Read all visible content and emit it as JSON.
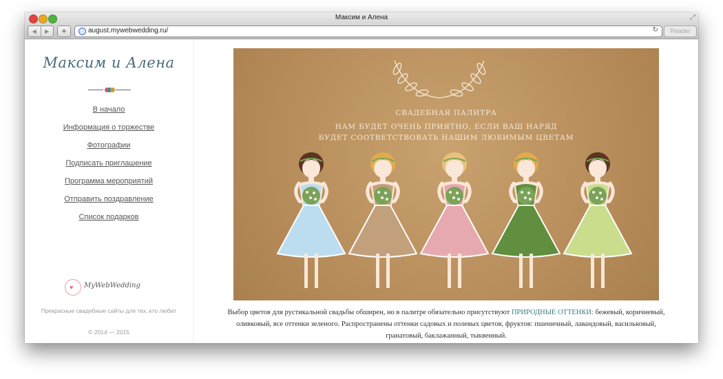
{
  "window": {
    "title": "Максим и Алена"
  },
  "toolbar": {
    "url": "august.mywebwedding.ru/",
    "reader_label": "Reader"
  },
  "icons": {
    "back": "back-arrow-icon",
    "forward": "forward-arrow-icon",
    "add_tab": "plus-icon",
    "site": "globe-icon",
    "reload": "reload-icon",
    "fullscreen": "fullscreen-icon",
    "hearts": "hearts-icon",
    "wreath": "laurel-wreath-icon"
  },
  "sidebar": {
    "logo_text": "Максим и Алена",
    "nav": [
      {
        "label": "В начало"
      },
      {
        "label": "Информация о торжестве"
      },
      {
        "label": "Фотографии"
      },
      {
        "label": "Подписать приглашение"
      },
      {
        "label": "Программа мероприятий"
      },
      {
        "label": "Отправить поздравление"
      },
      {
        "label": "Список подарков"
      }
    ],
    "footer": {
      "brand": "MyWebWedding",
      "tagline": "Прекрасные свадебные сайты для тех, кто любит",
      "copyright": "© 2014 — 2015"
    }
  },
  "hero": {
    "line1": "СВАДЕБНАЯ ПАЛИТРА",
    "line2": "НАМ БУДЕТ ОЧЕНЬ ПРИЯТНО, ЕСЛИ ВАШ НАРЯД",
    "line3": "БУДЕТ СООТВЕТСТВОВАТЬ НАШИМ ЛЮБИМЫМ ЦВЕТАМ",
    "dresses": [
      {
        "dress": "#bcdcef",
        "hair": "#5a3520"
      },
      {
        "dress": "#c1a07b",
        "hair": "#e0ab4b"
      },
      {
        "dress": "#e6a9b0",
        "hair": "#e8c27a"
      },
      {
        "dress": "#5f8f3f",
        "hair": "#e0ab4b"
      },
      {
        "dress": "#c9dd8d",
        "hair": "#5a3520"
      }
    ],
    "skin": "#fbe7d8",
    "bouquet": "#7aa35a"
  },
  "caption": {
    "part1": "Выбор цветов для рустикальной свадьбы обширен, но в палитре обязательно присутствуют ",
    "highlight": "ПРИРОДНЫЕ ОТТЕНКИ:",
    "part2": " бежевый, коричневый, оливковый, все оттенки зеленого. Распространены оттенки садовых и полевых цветов, фруктов: пшеничный, лавандовый, васильковый, гранатовый, баклажанный, тыквенный."
  }
}
